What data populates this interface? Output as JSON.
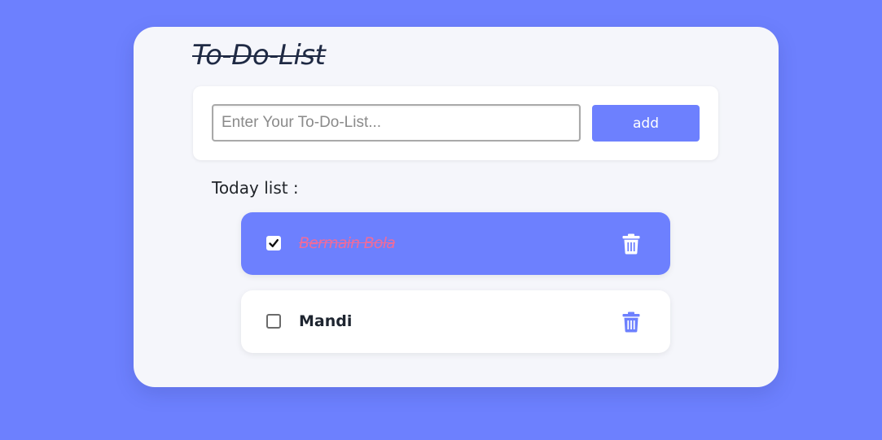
{
  "app": {
    "title": "To-Do-List"
  },
  "composer": {
    "placeholder": "Enter Your To-Do-List...",
    "value": "",
    "add_label": "add"
  },
  "list": {
    "heading": "Today list :",
    "items": [
      {
        "text": "Bermain Bola",
        "completed": true,
        "delete_icon": "trash-icon"
      },
      {
        "text": "Mandi",
        "completed": false,
        "delete_icon": "trash-icon"
      }
    ]
  },
  "colors": {
    "background": "#6d80fe",
    "card": "#f5f6fb",
    "accent": "#6d80fe",
    "completed_text": "#f06b9a",
    "text_dark": "#1e2530"
  }
}
